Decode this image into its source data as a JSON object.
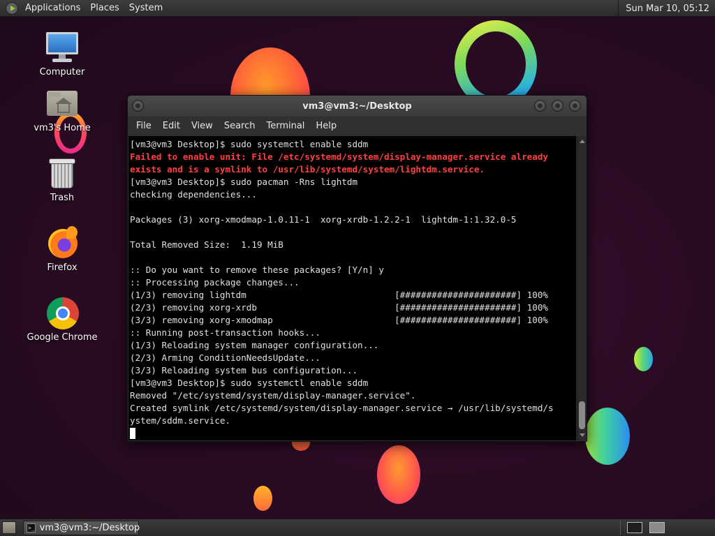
{
  "top_panel": {
    "menus": [
      "Applications",
      "Places",
      "System"
    ],
    "clock": "Sun Mar 10, 05:12"
  },
  "desktop_icons": [
    {
      "label": "Computer",
      "icon": "computer-icon"
    },
    {
      "label": "vm3's Home",
      "icon": "home-folder-icon"
    },
    {
      "label": "Trash",
      "icon": "trash-icon"
    },
    {
      "label": "Firefox",
      "icon": "firefox-icon"
    },
    {
      "label": "Google Chrome",
      "icon": "chrome-icon"
    }
  ],
  "terminal": {
    "title": "vm3@vm3:~/Desktop",
    "menu": [
      "File",
      "Edit",
      "View",
      "Search",
      "Terminal",
      "Help"
    ],
    "lines": [
      {
        "text": "[vm3@vm3 Desktop]$ sudo systemctl enable sddm",
        "error": false
      },
      {
        "text": "Failed to enable unit: File /etc/systemd/system/display-manager.service already",
        "error": true
      },
      {
        "text": "exists and is a symlink to /usr/lib/systemd/system/lightdm.service.",
        "error": true
      },
      {
        "text": "[vm3@vm3 Desktop]$ sudo pacman -Rns lightdm",
        "error": false
      },
      {
        "text": "checking dependencies...",
        "error": false
      },
      {
        "text": "",
        "error": false
      },
      {
        "text": "Packages (3) xorg-xmodmap-1.0.11-1  xorg-xrdb-1.2.2-1  lightdm-1:1.32.0-5",
        "error": false
      },
      {
        "text": "",
        "error": false
      },
      {
        "text": "Total Removed Size:  1.19 MiB",
        "error": false
      },
      {
        "text": "",
        "error": false
      },
      {
        "text": ":: Do you want to remove these packages? [Y/n] y",
        "error": false
      },
      {
        "text": ":: Processing package changes...",
        "error": false
      },
      {
        "text": "(1/3) removing lightdm                            [######################] 100%",
        "error": false
      },
      {
        "text": "(2/3) removing xorg-xrdb                          [######################] 100%",
        "error": false
      },
      {
        "text": "(3/3) removing xorg-xmodmap                       [######################] 100%",
        "error": false
      },
      {
        "text": ":: Running post-transaction hooks...",
        "error": false
      },
      {
        "text": "(1/3) Reloading system manager configuration...",
        "error": false
      },
      {
        "text": "(2/3) Arming ConditionNeedsUpdate...",
        "error": false
      },
      {
        "text": "(3/3) Reloading system bus configuration...",
        "error": false
      },
      {
        "text": "[vm3@vm3 Desktop]$ sudo systemctl enable sddm",
        "error": false
      },
      {
        "text": "Removed \"/etc/systemd/system/display-manager.service\".",
        "error": false
      },
      {
        "text": "Created symlink /etc/systemd/system/display-manager.service → /usr/lib/systemd/s",
        "error": false
      },
      {
        "text": "ystem/sddm.service.",
        "error": false
      }
    ]
  },
  "bottom_panel": {
    "task_label": "vm3@vm3:~/Desktop",
    "task_icon_text": ">_"
  },
  "colors": {
    "error_text": "#ff4040",
    "terminal_bg": "#000000",
    "terminal_fg": "#e0e0e0",
    "desktop_bg": "#2a0b24"
  }
}
